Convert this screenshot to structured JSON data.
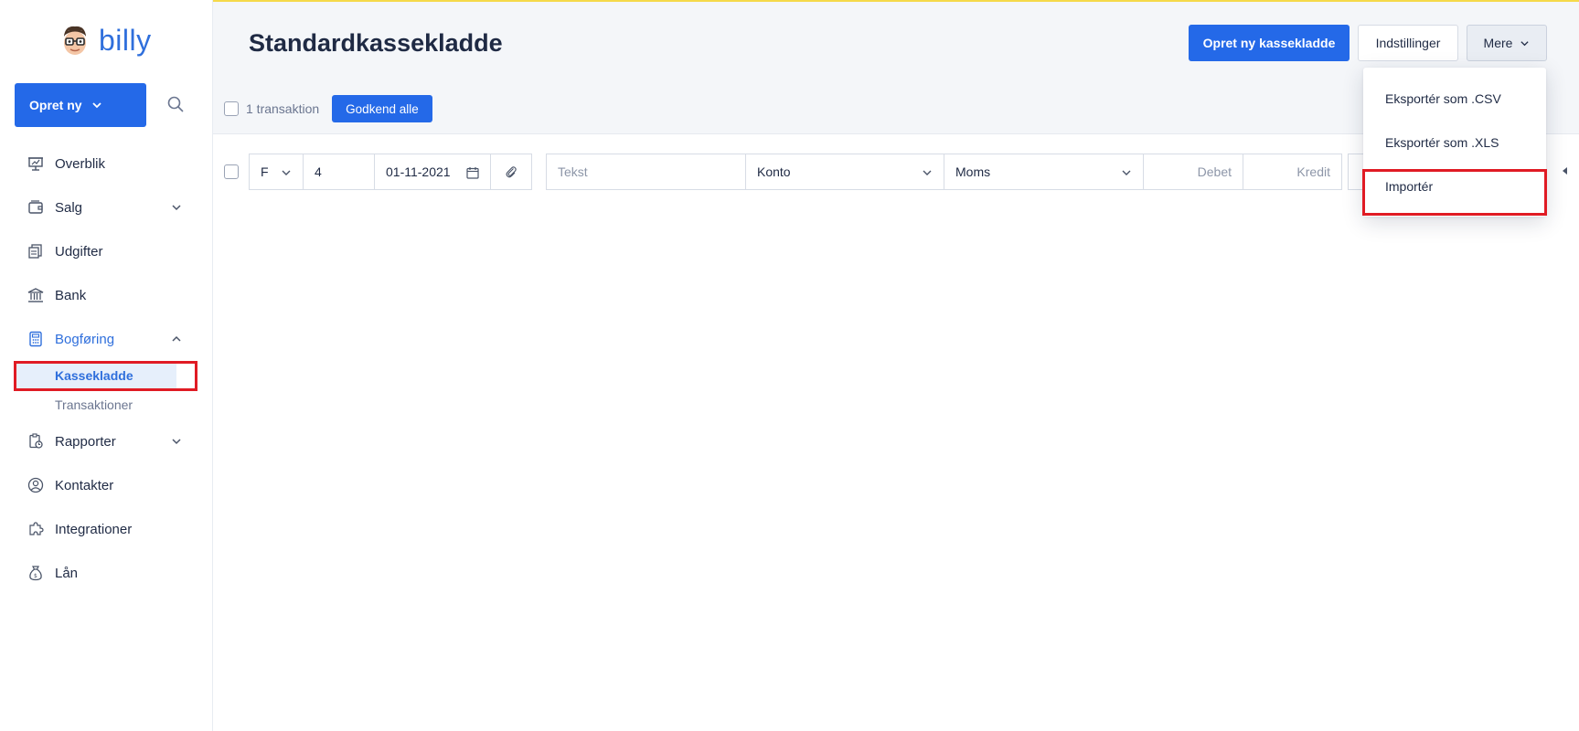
{
  "app": {
    "logo_text": "billy"
  },
  "sidebar": {
    "create_label": "Opret ny",
    "items": [
      {
        "label": "Overblik",
        "icon": "presentation-icon"
      },
      {
        "label": "Salg",
        "icon": "wallet-icon"
      },
      {
        "label": "Udgifter",
        "icon": "receipts-icon"
      },
      {
        "label": "Bank",
        "icon": "bank-icon"
      },
      {
        "label": "Bogføring",
        "icon": "calculator-icon"
      },
      {
        "label": "Rapporter",
        "icon": "report-icon"
      },
      {
        "label": "Kontakter",
        "icon": "contacts-icon"
      },
      {
        "label": "Integrationer",
        "icon": "puzzle-icon"
      },
      {
        "label": "Lån",
        "icon": "money-bag-icon"
      }
    ],
    "bogforing_sub": [
      {
        "label": "Kassekladde"
      },
      {
        "label": "Transaktioner"
      }
    ]
  },
  "header": {
    "title": "Standardkassekladde",
    "new_button": "Opret ny kassekladde",
    "settings_button": "Indstillinger",
    "more_button": "Mere"
  },
  "bulk": {
    "count_text": "1 transaktion",
    "approve_button": "Godkend alle"
  },
  "entry_row": {
    "type_value": "F",
    "number_value": "4",
    "date_value": "01-11-2021",
    "text_placeholder": "Tekst",
    "account_placeholder": "Konto",
    "vat_placeholder": "Moms",
    "debit_placeholder": "Debet",
    "credit_placeholder": "Kredit"
  },
  "more_menu": {
    "items": [
      {
        "label": "Eksportér som .CSV"
      },
      {
        "label": "Eksportér som .XLS"
      },
      {
        "label": "Importér"
      }
    ]
  },
  "colors": {
    "accent": "#2469e8",
    "highlight": "#e01b24",
    "topline": "#f5d94a"
  }
}
